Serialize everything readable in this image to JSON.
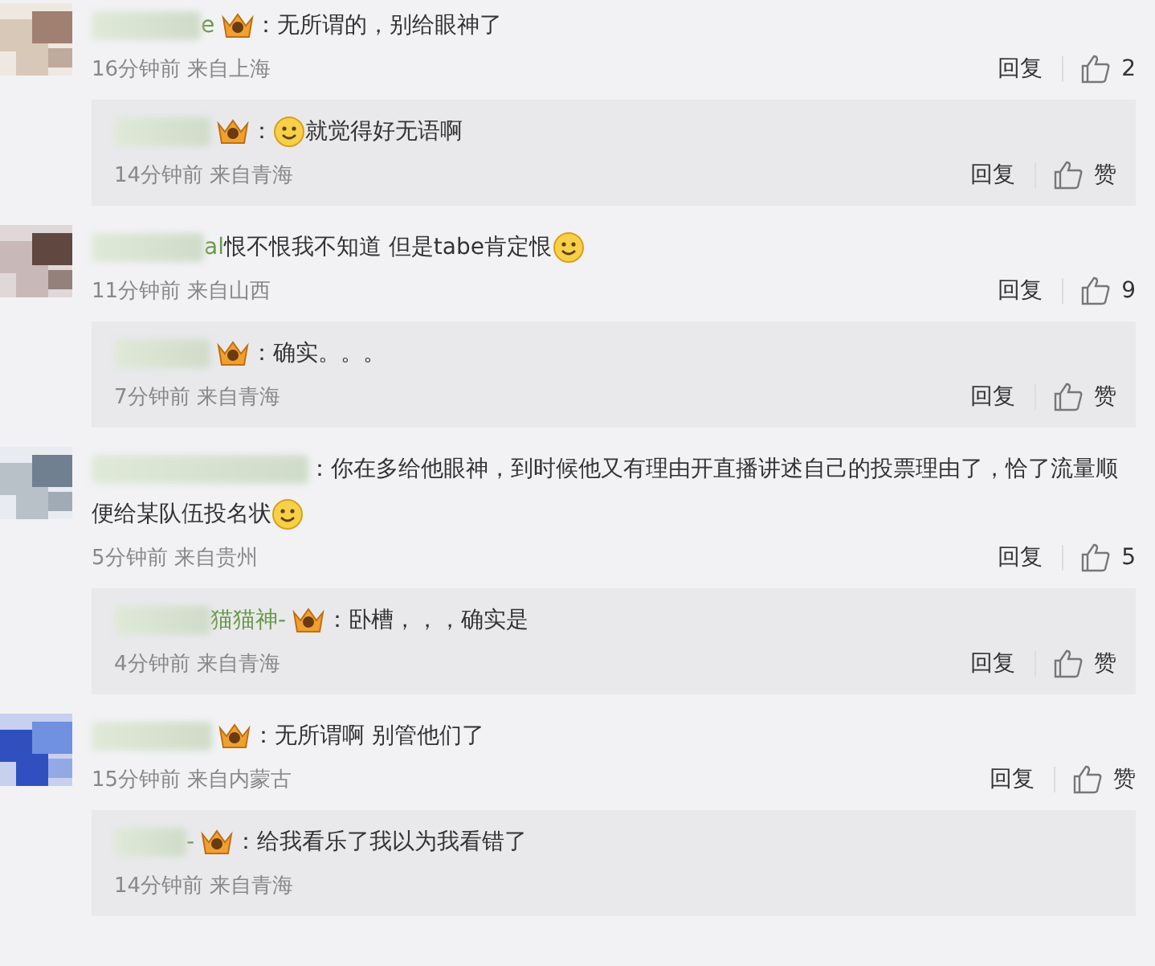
{
  "comments": [
    {
      "name_tail": "e",
      "badge": true,
      "parts": [
        {
          "kind": "text",
          "text": "：无所谓的，别给眼神了"
        }
      ],
      "meta": "16分钟前 来自上海",
      "reply_label": "回复",
      "likes": "2",
      "replies": [
        {
          "badge": true,
          "parts": [
            {
              "kind": "text",
              "text": "："
            },
            {
              "kind": "emoji"
            },
            {
              "kind": "text",
              "text": "就觉得好无语啊"
            }
          ],
          "meta": "14分钟前 来自青海",
          "reply_label": "回复",
          "likes": "赞"
        }
      ]
    },
    {
      "name_tail": "al",
      "badge": false,
      "parts": [
        {
          "kind": "text",
          "text": "恨不恨我不知道 但是tabe肯定恨"
        },
        {
          "kind": "emoji"
        }
      ],
      "meta": "11分钟前 来自山西",
      "reply_label": "回复",
      "likes": "9",
      "replies": [
        {
          "badge": true,
          "parts": [
            {
              "kind": "text",
              "text": "：确实。。。"
            }
          ],
          "meta": "7分钟前 来自青海",
          "reply_label": "回复",
          "likes": "赞"
        }
      ]
    },
    {
      "badge": false,
      "parts": [
        {
          "kind": "text",
          "text": "：你在多给他眼神，到时候他又有理由开直播讲述自己的投票理由了，恰了流量顺便给某队伍投名状"
        },
        {
          "kind": "emoji"
        }
      ],
      "meta": "5分钟前 来自贵州",
      "reply_label": "回复",
      "likes": "5",
      "replies": [
        {
          "name_tail": "猫猫神-",
          "badge": true,
          "parts": [
            {
              "kind": "text",
              "text": "：卧槽，，，确实是"
            }
          ],
          "meta": "4分钟前 来自青海",
          "reply_label": "回复",
          "likes": "赞"
        }
      ]
    },
    {
      "badge": true,
      "parts": [
        {
          "kind": "text",
          "text": "：无所谓啊 别管他们了"
        }
      ],
      "meta": "15分钟前 来自内蒙古",
      "reply_label": "回复",
      "likes": "赞",
      "replies": [
        {
          "name_tail": "-",
          "badge": true,
          "parts": [
            {
              "kind": "text",
              "text": "：给我看乐了我以为我看错了"
            }
          ],
          "meta": "14分钟前 来自青海"
        }
      ]
    }
  ]
}
